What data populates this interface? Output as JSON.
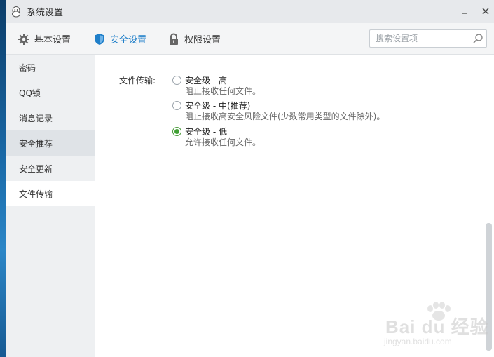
{
  "window": {
    "title": "系统设置",
    "minimize_label": "—",
    "close_label": "✕"
  },
  "toolbar": {
    "tabs": [
      {
        "label": "基本设置",
        "icon": "gear-icon"
      },
      {
        "label": "安全设置",
        "icon": "shield-icon",
        "active": true
      },
      {
        "label": "权限设置",
        "icon": "lock-icon"
      }
    ],
    "search": {
      "placeholder": "搜索设置项",
      "value": ""
    }
  },
  "sidebar": {
    "items": [
      {
        "label": "密码"
      },
      {
        "label": "QQ锁"
      },
      {
        "label": "消息记录"
      },
      {
        "label": "安全推荐",
        "state": "hover"
      },
      {
        "label": "安全更新"
      },
      {
        "label": "文件传输",
        "state": "selected"
      }
    ]
  },
  "content": {
    "section_label": "文件传输:",
    "options": [
      {
        "title": "安全级 - 高",
        "desc": "阻止接收任何文件。",
        "checked": false
      },
      {
        "title": "安全级 - 中(推荐)",
        "desc": "阻止接收高安全风险文件(少数常用类型的文件除外)。",
        "checked": false
      },
      {
        "title": "安全级 - 低",
        "desc": "允许接收任何文件。",
        "checked": true
      }
    ]
  },
  "watermark": {
    "main": "Bai du 经验",
    "sub": "jingyan.baidu.com"
  },
  "colors": {
    "accent": "#1f7fc9",
    "radio_checked": "#3fa033",
    "sidebar_bg": "#eef0f2"
  }
}
